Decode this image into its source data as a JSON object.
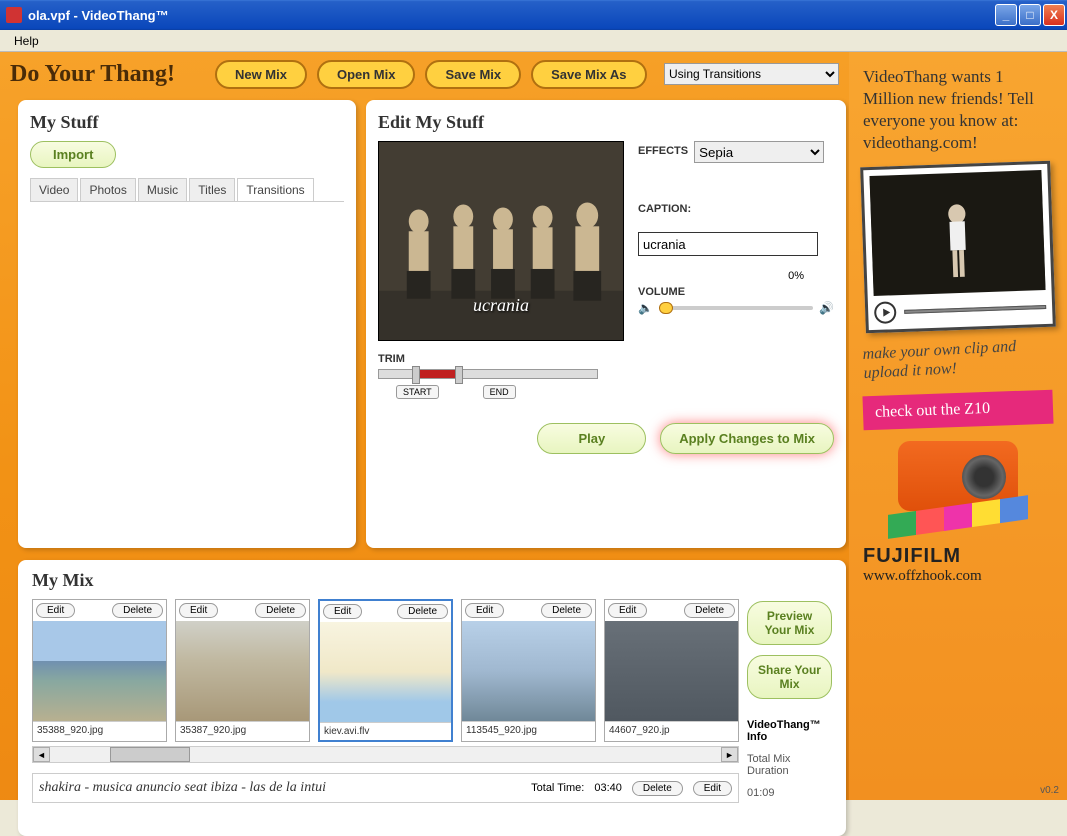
{
  "window": {
    "title": "ola.vpf - VideoThang™"
  },
  "menubar": {
    "help": "Help"
  },
  "header": {
    "logo": "Do Your Thang!",
    "new_mix": "New Mix",
    "open_mix": "Open Mix",
    "save_mix": "Save Mix",
    "save_mix_as": "Save Mix As",
    "help_dropdown": "Using Transitions"
  },
  "my_stuff": {
    "title": "My Stuff",
    "import": "Import",
    "tabs": [
      "Video",
      "Photos",
      "Music",
      "Titles",
      "Transitions"
    ],
    "active_tab": 4
  },
  "edit": {
    "title": "Edit My Stuff",
    "effects_label": "EFFECTS",
    "effects_value": "Sepia",
    "caption_label": "CAPTION:",
    "caption_value": "ucrania",
    "preview_caption": "ucrania",
    "volume_label": "VOLUME",
    "volume_pct": "0%",
    "trim_label": "TRIM",
    "trim_start": "START",
    "trim_end": "END",
    "play": "Play",
    "apply": "Apply Changes to Mix"
  },
  "my_mix": {
    "title": "My Mix",
    "clip_edit": "Edit",
    "clip_delete": "Delete",
    "clips": [
      {
        "name": "35388_920.jpg",
        "thumb": "thumb-beach",
        "selected": false
      },
      {
        "name": "35387_920.jpg",
        "thumb": "thumb-city",
        "selected": false
      },
      {
        "name": "kiev.avi.flv",
        "thumb": "thumb-map",
        "selected": true
      },
      {
        "name": "113545_920.jpg",
        "thumb": "thumb-harbor",
        "selected": false
      },
      {
        "name": "44607_920.jp",
        "thumb": "thumb-dark",
        "selected": false
      }
    ],
    "preview": "Preview Your Mix",
    "share": "Share Your Mix",
    "info_title": "VideoThang™ Info",
    "duration_label": "Total Mix Duration",
    "duration_value": "01:09",
    "audio_text": "shakira - musica anuncio seat ibiza - las de la intui",
    "total_time_label": "Total Time:",
    "total_time_value": "03:40",
    "delete": "Delete",
    "edit": "Edit"
  },
  "sidebar": {
    "promo": "VideoThang wants 1 Million new friends! Tell everyone you know at: videothang.com!",
    "handwriting": "make your own clip and upload it now!",
    "pink_banner": "check out the Z10",
    "fuji": "FUJIFILM",
    "url": "www.offzhook.com",
    "version": "v0.2"
  }
}
